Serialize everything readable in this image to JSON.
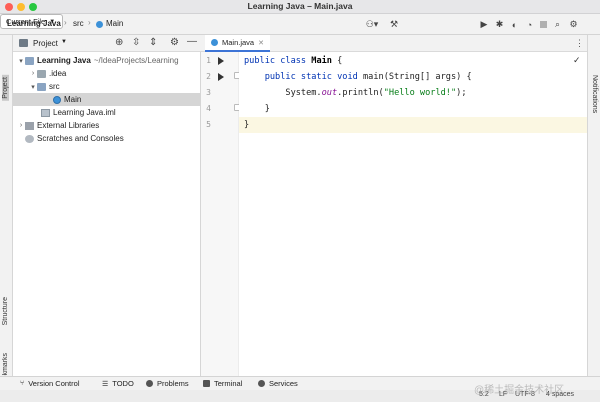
{
  "window": {
    "title": "Learning Java – Main.java",
    "traffic_colors": [
      "#fe5f57",
      "#febc2e",
      "#28c840"
    ]
  },
  "navbar": {
    "breadcrumb": [
      "Learning Java",
      "src",
      "Main"
    ],
    "run_config": "Current File"
  },
  "side_tools": {
    "project": "Project",
    "structure": "Structure",
    "bookmarks": "Bookmarks",
    "notifications": "Notifications"
  },
  "project_panel": {
    "title": "Project",
    "tree": [
      {
        "label": "Learning Java",
        "path": "~/IdeaProjects/Learning",
        "bold": true,
        "expanded": true
      },
      {
        "label": ".idea",
        "expanded": false
      },
      {
        "label": "src",
        "expanded": true
      },
      {
        "label": "Main",
        "selected": true
      },
      {
        "label": "Learning Java.iml"
      },
      {
        "label": "External Libraries",
        "expanded": false
      },
      {
        "label": "Scratches and Consoles"
      }
    ]
  },
  "editor": {
    "tab_label": "Main.java",
    "line_numbers": [
      "1",
      "2",
      "3",
      "4",
      "5"
    ],
    "code": {
      "l1_kw": "public class ",
      "l1_cls": "Main",
      "l1_brace": " {",
      "l2_kw": "    public static void ",
      "l2_rest": "main(String[] args) {",
      "l3_pre": "        System.",
      "l3_out": "out",
      "l3_mid": ".println(",
      "l3_str": "\"Hello world!\"",
      "l3_end": ");",
      "l4": "    }",
      "l5": "}"
    }
  },
  "statusbar": {
    "version_control": "Version Control",
    "todo": "TODO",
    "problems": "Problems",
    "terminal": "Terminal",
    "services": "Services"
  },
  "bottombar": {
    "position": "5:2",
    "line_sep": "LF",
    "encoding": "UTF-8",
    "indent": "4 spaces"
  },
  "watermark": "@稀土掘金技术社区",
  "icons": [
    "git-icon",
    "hammer-icon",
    "run-icon",
    "debug-icon",
    "coverage-icon",
    "stop-icon",
    "search-icon",
    "gear-icon",
    "target-icon",
    "expand-icon",
    "collapse-icon",
    "minimize-icon",
    "check-icon"
  ]
}
